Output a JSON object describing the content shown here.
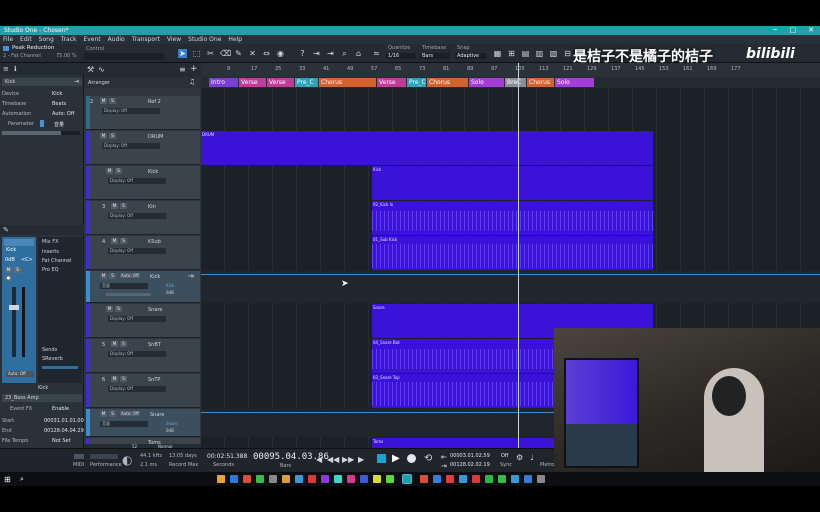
{
  "window": {
    "title": "Studio One - Chosen*",
    "controls": [
      "─",
      "□",
      "✕"
    ]
  },
  "menu": [
    "File",
    "Edit",
    "Song",
    "Track",
    "Event",
    "Audio",
    "Transport",
    "View",
    "Studio One",
    "Help"
  ],
  "toolbar": {
    "preset_name": "Peak Reduction",
    "preset_sub": "2 - Fat Channel",
    "preset_pct": "75.00 %",
    "control_label": "Control",
    "quantize_label": "Quantize",
    "quantize_value": "1/16",
    "timebase_label": "Timebase",
    "timebase_value": "Bars",
    "snap_label": "Snap",
    "snap_value": "Adaptive"
  },
  "inspector": {
    "track_name": "Kick",
    "device_label": "Device",
    "device_value": "Kick",
    "timebase_label": "Timebase",
    "timebase_value": "Beats",
    "automation_label": "Automation",
    "automation_value": "Auto: Off",
    "param_label": "Parameter",
    "param_value": "音量",
    "channel_name": "Kick",
    "mixfx": "Mix FX",
    "inserts": [
      "Inserts",
      "Fat Channel",
      "Pro EQ"
    ],
    "sends_label": "Sends",
    "sends_value": "SReverb",
    "volume": "0dB",
    "pan": "<C>",
    "auto_label": "Auto: Off",
    "channel_footer": "Kick",
    "event_track": "23_Bass Amp",
    "event_fx": "Event FX",
    "enable": "Enable",
    "start_label": "Start",
    "start_value": "00031.01.01.00",
    "end_label": "End",
    "end_value": "00128.04.04.29",
    "tempo_label": "File Tempo",
    "tempo_value": "Not Set"
  },
  "arranger_label": "Arranger",
  "ruler_ticks": [
    "9",
    "17",
    "25",
    "33",
    "41",
    "49",
    "57",
    "65",
    "73",
    "81",
    "89",
    "97",
    "105",
    "113",
    "121",
    "129",
    "137",
    "145",
    "153",
    "161",
    "169",
    "177"
  ],
  "markers": [
    {
      "label": "Intro",
      "color": "#7b3fd8"
    },
    {
      "label": "Verse",
      "color": "#c23b9a"
    },
    {
      "label": "Verse",
      "color": "#c23b9a"
    },
    {
      "label": "Pre_C",
      "color": "#2aa3b8"
    },
    {
      "label": "Chorus",
      "color": "#d4622a"
    },
    {
      "label": "Verse",
      "color": "#c23b9a"
    },
    {
      "label": "Pre_C",
      "color": "#2aa3b8"
    },
    {
      "label": "Chorus",
      "color": "#d4622a"
    },
    {
      "label": "Solo",
      "color": "#a53bd8"
    },
    {
      "label": "BreC",
      "color": "#8a8f96"
    },
    {
      "label": "Chorus",
      "color": "#d4622a"
    },
    {
      "label": "Solo",
      "color": "#a53bd8"
    }
  ],
  "tracks": [
    {
      "num": "2",
      "name": "Ref 2",
      "display": "Display: Off"
    },
    {
      "num": "",
      "name": "DRUM",
      "display": "Display: Off"
    },
    {
      "num": "",
      "name": "Kick",
      "display": "Display: Off"
    },
    {
      "num": "3",
      "name": "Kin",
      "display": "Display: Off"
    },
    {
      "num": "4",
      "name": "KSub",
      "display": "Display: Off"
    },
    {
      "num": "",
      "name": "Kick",
      "display": "音量",
      "auto": "Auto: Off",
      "extra": "Kick",
      "db": "0dB"
    },
    {
      "num": "",
      "name": "Snare",
      "display": "Display: Off"
    },
    {
      "num": "5",
      "name": "SnBT",
      "display": "Display: Off"
    },
    {
      "num": "6",
      "name": "SnTP",
      "display": "Display: Off"
    },
    {
      "num": "",
      "name": "Snare",
      "display": "音量",
      "auto": "Auto: Off",
      "extra": "Snare",
      "db": "0dB"
    },
    {
      "num": "",
      "name": "Toms",
      "display": ""
    }
  ],
  "clips": {
    "drum": "DRUM",
    "kick": "Kick",
    "kick_in": "02_Kick In",
    "sub_kick": "01_Sub Kick",
    "snare": "Snare",
    "snare_bot": "04_Snare Bot",
    "snare_top": "03_Snare Top",
    "toms": "Toms"
  },
  "transport": {
    "midi": "MIDI",
    "performance": "Performance",
    "sample_rate": "44.1 kHz",
    "latency": "2.1 ms",
    "record_days": "13:05 days",
    "record_max": "Record Max",
    "seconds_value": "00:02:51.388",
    "seconds_label": "Seconds",
    "bars_value": "00095.04.03.86",
    "bars_label": "Bars",
    "loop_start": "00003.01.02.59",
    "loop_end": "00128.02.02.19",
    "sync": "Off",
    "sync_label": "Sync",
    "metronome": "Metron."
  },
  "watermark": "是桔子不是橘子的桔子",
  "bili_logo": "bilibili",
  "inspector_bottom": {
    "normal": "Normal",
    "zoom": "52"
  }
}
